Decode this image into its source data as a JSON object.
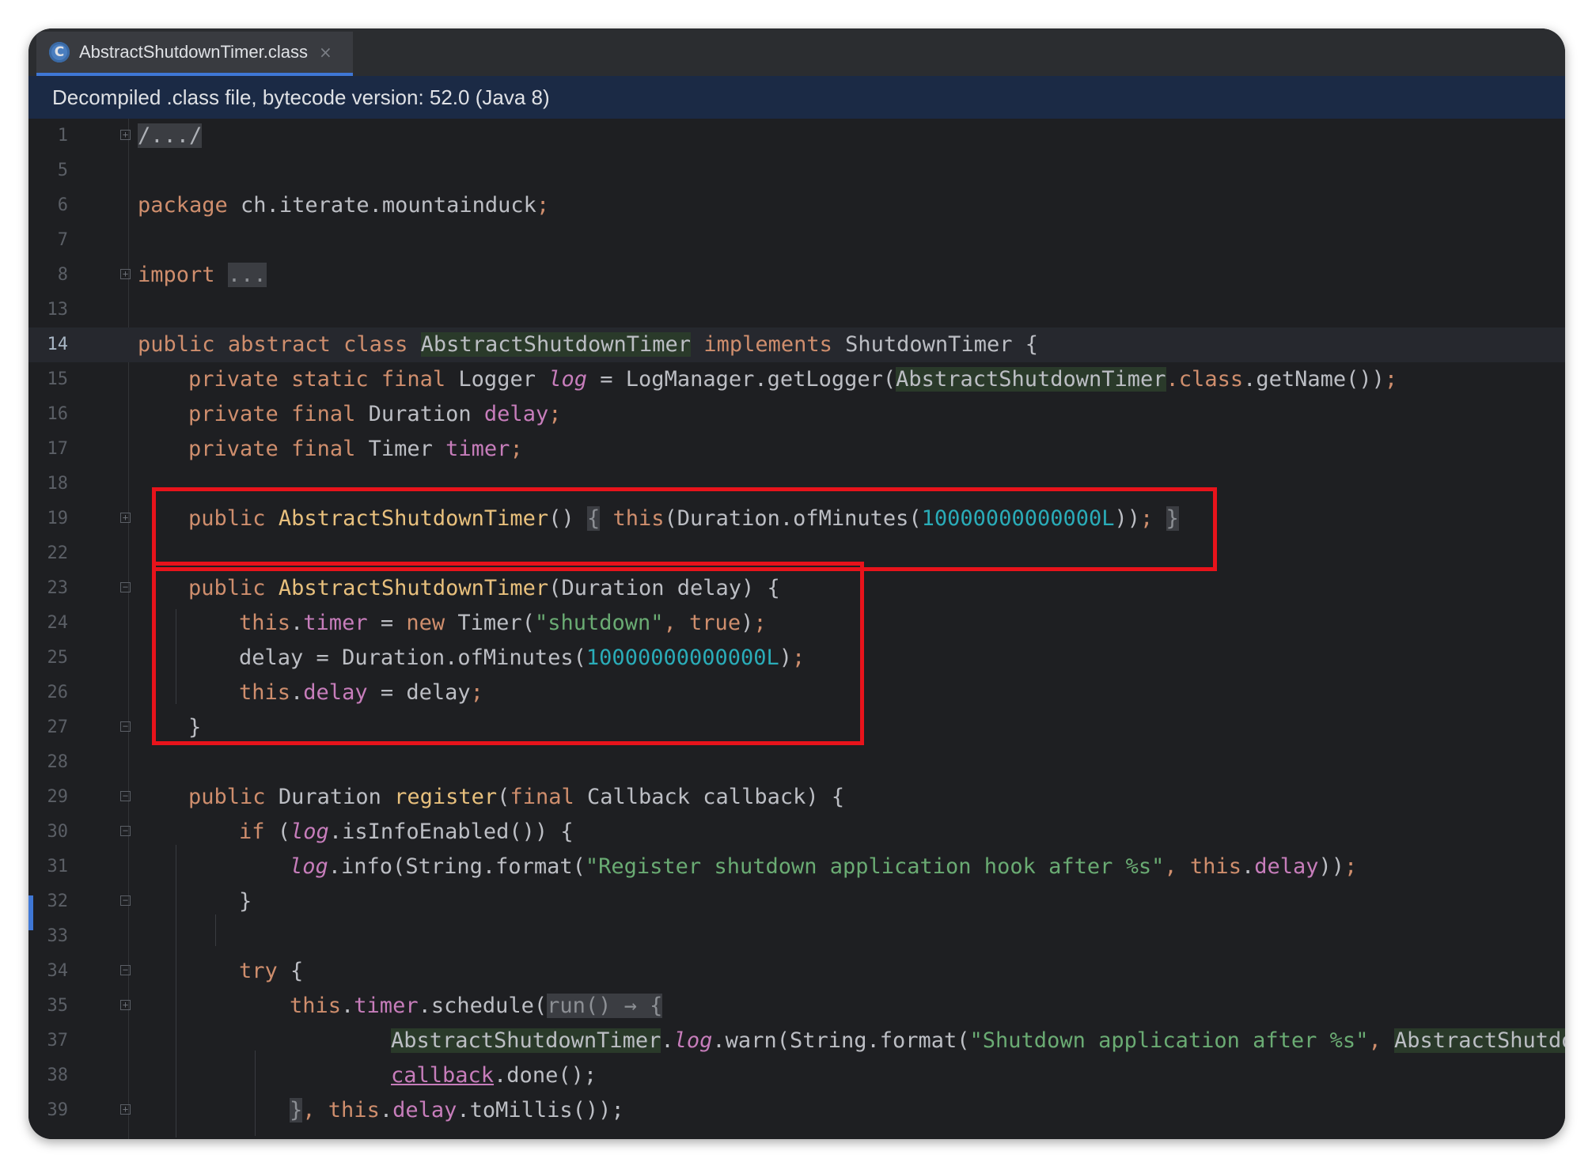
{
  "tab": {
    "filename": "AbstractShutdownTimer.class",
    "icon_letter": "C",
    "close_glyph": "×"
  },
  "banner": {
    "text": "Decompiled .class file, bytecode version: 52.0 (Java 8)"
  },
  "editor": {
    "current_line": "14",
    "lines": [
      {
        "n": "1"
      },
      {
        "n": "5"
      },
      {
        "n": "6"
      },
      {
        "n": "7"
      },
      {
        "n": "8"
      },
      {
        "n": "13"
      },
      {
        "n": "14"
      },
      {
        "n": "15"
      },
      {
        "n": "16"
      },
      {
        "n": "17"
      },
      {
        "n": "18"
      },
      {
        "n": "19"
      },
      {
        "n": "22"
      },
      {
        "n": "23"
      },
      {
        "n": "24"
      },
      {
        "n": "25"
      },
      {
        "n": "26"
      },
      {
        "n": "27"
      },
      {
        "n": "28"
      },
      {
        "n": "29"
      },
      {
        "n": "30"
      },
      {
        "n": "31"
      },
      {
        "n": "32"
      },
      {
        "n": "33"
      },
      {
        "n": "34"
      },
      {
        "n": "35"
      },
      {
        "n": "37"
      },
      {
        "n": "38"
      },
      {
        "n": "39"
      }
    ],
    "tokens": {
      "l1_folded": "/.../",
      "l6_package": "package",
      "l6_name": " ch.iterate.mountainduck",
      "semi": ";",
      "l8_import": "import",
      "l8_folded": "...",
      "public": "public",
      "abstract": "abstract",
      "class": "class",
      "private": "private",
      "static": "static",
      "final": "final",
      "this": "this",
      "new": "new",
      "true": "true",
      "if": "if",
      "try": "try",
      "classname": "AbstractShutdownTimer",
      "classname_trunc": "AbstractShutdow",
      "implements": "implements",
      "interface": "ShutdownTimer",
      "Logger": "Logger",
      "log": "log",
      "LogManager_getLogger": "LogManager.getLogger(",
      "class_suffix": ".class",
      "getName": ".getName())",
      "Duration": "Duration",
      "delay": "delay",
      "Timer": "Timer",
      "timer": "timer",
      "ofMinutes": "Duration.ofMinutes(",
      "big_number": "10000000000000L",
      "str_shutdown": "\"shutdown\"",
      "register": "register",
      "Callback": "Callback",
      "callback": "callback",
      "isInfoEnabled": ".isInfoEnabled()) {",
      "info": ".info(String.format(",
      "str_register": "\"Register shutdown application hook after %s\"",
      "schedule": ".schedule(",
      "run_hint": "run() → {",
      "warn": ".warn(String.format(",
      "str_shutdown_after": "\"Shutdown application after %s\"",
      "done": ".done();",
      "toMillis": ".toMillis());"
    }
  }
}
